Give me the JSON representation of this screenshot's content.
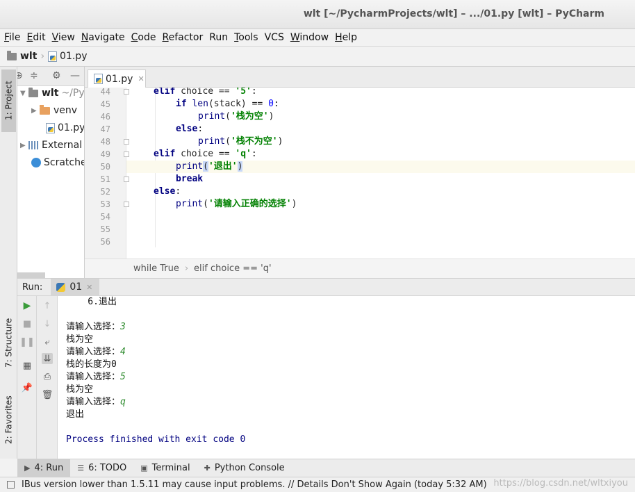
{
  "window": {
    "title": "wlt [~/PycharmProjects/wlt] – .../01.py [wlt] – PyCharm"
  },
  "menu": [
    {
      "u": "F",
      "rest": "ile"
    },
    {
      "u": "E",
      "rest": "dit"
    },
    {
      "u": "V",
      "rest": "iew"
    },
    {
      "u": "N",
      "rest": "avigate"
    },
    {
      "u": "C",
      "rest": "ode"
    },
    {
      "u": "R",
      "rest": "efactor"
    },
    {
      "u": "",
      "rest": "Run"
    },
    {
      "u": "T",
      "rest": "ools"
    },
    {
      "u": "",
      "rest": "VCS"
    },
    {
      "u": "W",
      "rest": "indow"
    },
    {
      "u": "H",
      "rest": "elp"
    }
  ],
  "nav": {
    "project": "wlt",
    "file": "01.py"
  },
  "left_strip": {
    "project": "1: Project",
    "structure": "7: Structure",
    "favorites": "2: Favorites"
  },
  "project_tree": {
    "root": "wlt",
    "root_path": "~/Py",
    "venv": "venv",
    "file": "01.py",
    "external": "External",
    "scratches": "Scratche"
  },
  "editor_tab": {
    "label": "01.py"
  },
  "editor": {
    "line_numbers": [
      "44",
      "45",
      "46",
      "47",
      "48",
      "49",
      "50",
      "51",
      "52",
      "53",
      "54",
      "55",
      "56"
    ],
    "current_line": "50"
  },
  "code": {
    "l44_kw": "elif",
    "l44_rest": " choice == ",
    "l44_str": "'5'",
    "l44_end": ":",
    "l45_kw": "if",
    "l45_fn": " len",
    "l45_rest": "(stack) == ",
    "l45_num": "0",
    "l45_end": ":",
    "l46_fn": "print",
    "l46_open": "(",
    "l46_str": "'栈为空'",
    "l46_close": ")",
    "l47_kw": "else",
    "l47_end": ":",
    "l48_fn": "print",
    "l48_open": "(",
    "l48_str": "'栈不为空'",
    "l48_close": ")",
    "l49_kw": "elif",
    "l49_rest": " choice == ",
    "l49_str": "'q'",
    "l49_end": ":",
    "l50_fn": "print",
    "l50_open": "(",
    "l50_str": "'退出'",
    "l50_close": ")",
    "l51_kw": "break",
    "l52_kw": "else",
    "l52_end": ":",
    "l53_fn": "print",
    "l53_open": "(",
    "l53_str": "'请输入正确的选择'",
    "l53_close": ")"
  },
  "editor_breadcrumbs": {
    "first": "while True",
    "second": "elif choice == 'q'"
  },
  "run": {
    "label": "Run:",
    "tab": "01"
  },
  "console": {
    "l1": "    6.退出",
    "l2": "",
    "l3_prompt": "请输入选择：",
    "l3_input": "3",
    "l4": "栈为空",
    "l5_prompt": "请输入选择：",
    "l5_input": "4",
    "l6": "栈的长度为0",
    "l7_prompt": "请输入选择：",
    "l7_input": "5",
    "l8": "栈为空",
    "l9_prompt": "请输入选择：",
    "l9_input": "q",
    "l10": "退出",
    "l11": "",
    "l12": "Process finished with exit code 0"
  },
  "bottom_tabs": {
    "run": "4: Run",
    "todo": "6: TODO",
    "terminal": "Terminal",
    "python_console": "Python Console"
  },
  "status": {
    "message": "IBus version lower than 1.5.11 may cause input problems. // Details Don't Show Again (today 5:32 AM)",
    "watermark": "https://blog.csdn.net/wltxiyou"
  },
  "icons": [
    "folder-icon",
    "python-file-icon",
    "settings-icon",
    "collapse-icon",
    "run-icon",
    "stop-icon",
    "pause-icon",
    "up-arrow-icon",
    "down-arrow-icon",
    "soft-wrap-icon",
    "scroll-to-end-icon",
    "print-icon",
    "trash-icon",
    "pin-icon",
    "layout-icon",
    "star-icon",
    "terminal-icon",
    "close-icon"
  ]
}
